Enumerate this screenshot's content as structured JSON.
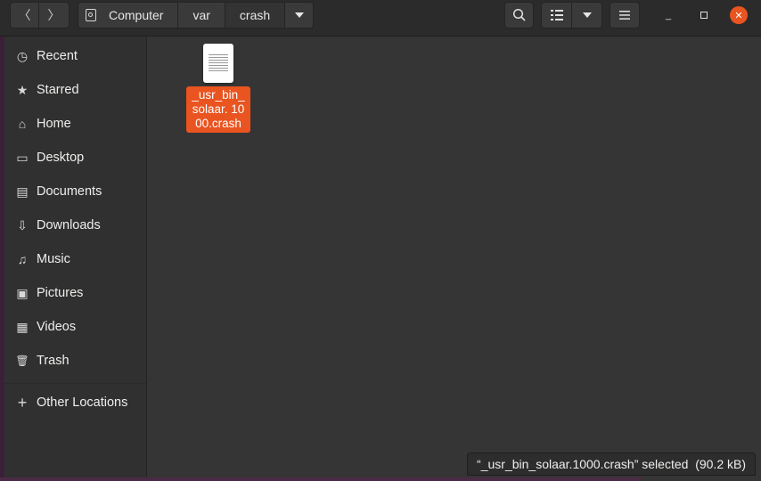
{
  "header": {
    "path": [
      "Computer",
      "var",
      "crash"
    ],
    "back_glyph": "〈",
    "forward_glyph": "〉",
    "search_icon": "search-icon",
    "view_icon": "list-view-icon",
    "menu_icon": "hamburger-menu-icon",
    "minimize_glyph": "—",
    "maximize_glyph": "▢",
    "close_glyph": "✕"
  },
  "sidebar": {
    "items": [
      {
        "label": "Recent",
        "icon": "◷"
      },
      {
        "label": "Starred",
        "icon": "★"
      },
      {
        "label": "Home",
        "icon": "⌂"
      },
      {
        "label": "Desktop",
        "icon": "▭"
      },
      {
        "label": "Documents",
        "icon": "▤"
      },
      {
        "label": "Downloads",
        "icon": "⇩"
      },
      {
        "label": "Music",
        "icon": "♫"
      },
      {
        "label": "Pictures",
        "icon": "▣"
      },
      {
        "label": "Videos",
        "icon": "▦"
      },
      {
        "label": "Trash",
        "icon": "🗑"
      },
      {
        "label": "Other Locations",
        "icon": "+"
      }
    ]
  },
  "files": [
    {
      "name": "_usr_bin_solaar.1000.crash",
      "display_name": "_usr_bin_ solaar. 1000.crash",
      "selected": true
    }
  ],
  "status": {
    "text": "“_usr_bin_solaar.1000.crash” selected  (90.2 kB)"
  },
  "colors": {
    "accent": "#e95420",
    "background": "#353535",
    "sidebar": "#303030",
    "header": "#2b2b2b"
  }
}
